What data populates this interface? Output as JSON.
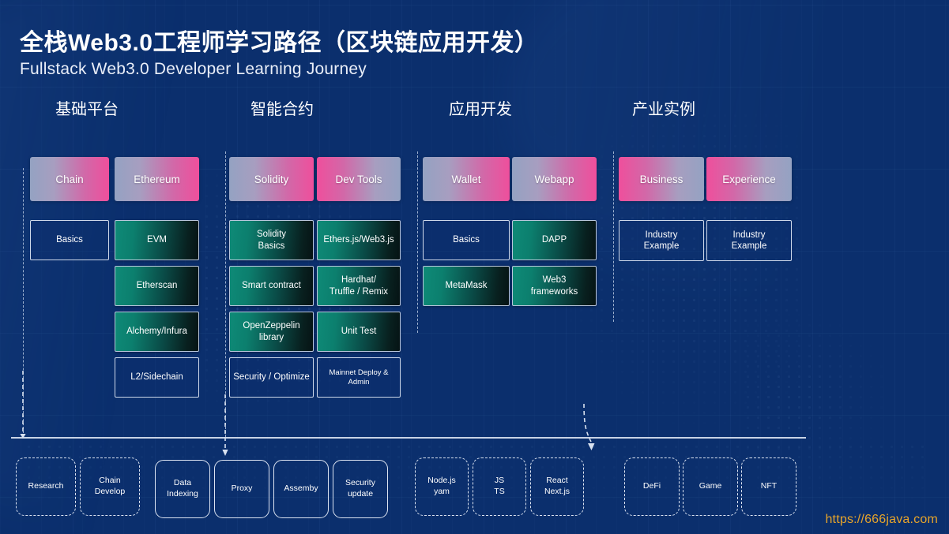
{
  "header": {
    "title_cn": "全栈Web3.0工程师学习路径（区块链应用开发）",
    "title_en": "Fullstack Web3.0 Developer Learning Journey"
  },
  "sections": [
    {
      "label": "基础平台"
    },
    {
      "label": "智能合约"
    },
    {
      "label": "应用开发"
    },
    {
      "label": "产业实例"
    }
  ],
  "top_cards": [
    {
      "label": "Chain",
      "gradient": "left-to-right"
    },
    {
      "label": "Ethereum",
      "gradient": "left-to-right"
    },
    {
      "label": "Solidity",
      "gradient": "left-to-right"
    },
    {
      "label": "Dev Tools",
      "gradient": "right-to-left"
    },
    {
      "label": "Wallet",
      "gradient": "left-to-right"
    },
    {
      "label": "Webapp",
      "gradient": "left-to-right"
    },
    {
      "label": "Business",
      "gradient": "right-to-left"
    },
    {
      "label": "Experience",
      "gradient": "right-to-left"
    }
  ],
  "matrix": [
    {
      "label": "Basics",
      "style": "outline"
    },
    {
      "label": "EVM",
      "style": "green"
    },
    {
      "label": "Etherscan",
      "style": "green"
    },
    {
      "label": "Alchemy/Infura",
      "style": "green"
    },
    {
      "label": "L2/Sidechain",
      "style": "outline"
    },
    {
      "label": "Solidity\nBasics",
      "style": "green"
    },
    {
      "label": "Ethers.js/Web3.js",
      "style": "green"
    },
    {
      "label": "Smart contract",
      "style": "green"
    },
    {
      "label": "Hardhat/\nTruffle / Remix",
      "style": "green"
    },
    {
      "label": "OpenZeppelin\nlibrary",
      "style": "green"
    },
    {
      "label": "Unit Test",
      "style": "green"
    },
    {
      "label": "Security / Optimize",
      "style": "outline"
    },
    {
      "label": "Mainnet Deploy & Admin",
      "style": "outline"
    },
    {
      "label": "Basics",
      "style": "outline"
    },
    {
      "label": "DAPP",
      "style": "green"
    },
    {
      "label": "MetaMask",
      "style": "green"
    },
    {
      "label": "Web3\nframeworks",
      "style": "green"
    },
    {
      "label": "Industry\nExample",
      "style": "outline"
    },
    {
      "label": "Industry\nExample",
      "style": "outline"
    }
  ],
  "bottom_pills": [
    {
      "label": "Research",
      "border": "dashed"
    },
    {
      "label": "Chain\nDevelop",
      "border": "dashed"
    },
    {
      "label": "Data\nIndexing",
      "border": "solid"
    },
    {
      "label": "Proxy",
      "border": "solid"
    },
    {
      "label": "Assemby",
      "border": "solid"
    },
    {
      "label": "Security\nupdate",
      "border": "solid"
    },
    {
      "label": "Node.js\nyam",
      "border": "dashed"
    },
    {
      "label": "JS\nTS",
      "border": "dashed"
    },
    {
      "label": "React\nNext.js",
      "border": "dashed"
    },
    {
      "label": "DeFi",
      "border": "dashed"
    },
    {
      "label": "Game",
      "border": "dashed"
    },
    {
      "label": "NFT",
      "border": "dashed"
    }
  ],
  "watermark": {
    "text": "https://666java.com"
  },
  "colors": {
    "background": "#0b2f6d",
    "accent_pink": "#ef4f9c",
    "accent_slate": "#94a2c2",
    "accent_green": "#0e8a77",
    "outline": "#cfd9ea",
    "watermark": "#e8a52a"
  }
}
